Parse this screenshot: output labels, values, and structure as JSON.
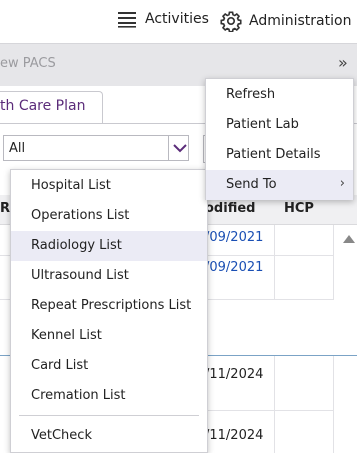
{
  "topbar": {
    "activities_label": "Activities",
    "administration_label": "Administration"
  },
  "toolbar": {
    "crumb": "ew PACS",
    "more_glyph": "»"
  },
  "tab": {
    "label": "th Care Plan"
  },
  "filter": {
    "value": "All"
  },
  "table": {
    "headers": {
      "re": "Re",
      "modified": "odified",
      "hcp": "HCP"
    },
    "dates": [
      "/09/2021",
      "/09/2021",
      "/11/2024",
      "/11/2024"
    ]
  },
  "list_menu": {
    "items": [
      "Hospital List",
      "Operations List",
      "Radiology List",
      "Ultrasound List",
      "Repeat Prescriptions List",
      "Kennel List",
      "Card List",
      "Cremation List",
      "VetCheck"
    ],
    "highlighted": "Radiology List"
  },
  "context_menu": {
    "items": [
      "Refresh",
      "Patient Lab",
      "Patient Details",
      "Send To"
    ],
    "highlighted": "Send To",
    "submenu_arrow": "›"
  },
  "colors": {
    "accent": "#5b2c7a",
    "link_blue": "#1a4fb4",
    "highlight": "#ebebf5"
  }
}
